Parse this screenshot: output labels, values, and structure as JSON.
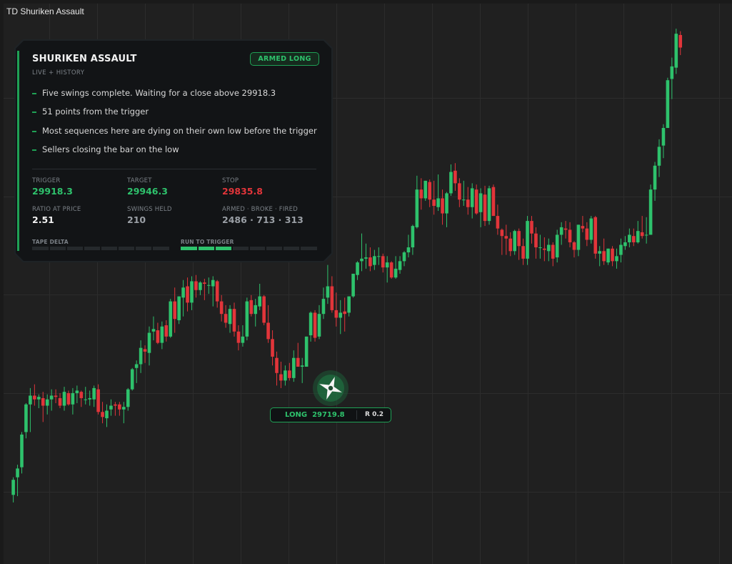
{
  "window": {
    "title": "TD Shuriken Assault"
  },
  "panel": {
    "title": "SHURIKEN ASSAULT",
    "subtitle": "LIVE + HISTORY",
    "status_badge": "ARMED LONG",
    "notes": [
      "Five swings complete. Waiting for a close above 29918.3",
      "51 points from the trigger",
      "Most sequences here are dying on their own low before the trigger",
      "Sellers closing the bar on the low"
    ],
    "stats": {
      "trigger": {
        "label": "TRIGGER",
        "value": "29918.3"
      },
      "target": {
        "label": "TARGET",
        "value": "29946.3"
      },
      "stop": {
        "label": "STOP",
        "value": "29835.8"
      },
      "ratio": {
        "label": "RATIO AT PRICE",
        "value": "2.51"
      },
      "swings": {
        "label": "SWINGS HELD",
        "value": "210"
      },
      "armed": {
        "label": "ARMED · BROKE · FIRED",
        "value": "2486 · 713 · 313"
      }
    },
    "tape_delta": {
      "label": "TAPE DELTA",
      "marker": 0.5
    },
    "run_to_trigger": {
      "label": "RUN TO TRIGGER",
      "progress": 0.375
    }
  },
  "trade_tag": {
    "side": "LONG",
    "price": "29719.8",
    "ratio": "R 0.2"
  },
  "colors": {
    "up": "#2ec26c",
    "down": "#e2353a",
    "accent": "#1fa155",
    "background": "#202020",
    "grid": "#2c2c2c"
  },
  "icons": {
    "signal": "shuriken-icon"
  },
  "chart_data": {
    "type": "candlestick",
    "title": "",
    "grid": true,
    "ylim": [
      29585,
      30031
    ],
    "candles": [
      [
        29640.0,
        29654.0,
        29634.0,
        29652.0
      ],
      [
        29654.0,
        29664.0,
        29639.0,
        29661.0
      ],
      [
        29662.0,
        29690.0,
        29657.0,
        29688.0
      ],
      [
        29690.0,
        29713.0,
        29685.0,
        29712.0
      ],
      [
        29712.0,
        29725.0,
        29690.0,
        29719.0
      ],
      [
        29719.0,
        29728.0,
        29711.0,
        29716.0
      ],
      [
        29716.0,
        29720.0,
        29709.0,
        29718.0
      ],
      [
        29717.0,
        29722.0,
        29698.0,
        29711.0
      ],
      [
        29711.0,
        29720.0,
        29704.0,
        29716.0
      ],
      [
        29716.0,
        29724.0,
        29707.0,
        29719.0
      ],
      [
        29719.0,
        29724.0,
        29713.0,
        29718.0
      ],
      [
        29717.0,
        29721.0,
        29709.0,
        29711.0
      ],
      [
        29711.0,
        29726.0,
        29707.0,
        29722.0
      ],
      [
        29721.0,
        29723.0,
        29711.0,
        29712.0
      ],
      [
        29712.0,
        29725.0,
        29704.0,
        29721.0
      ],
      [
        29721.0,
        29727.0,
        29713.0,
        29723.0
      ],
      [
        29722.0,
        29723.0,
        29710.0,
        29717.0
      ],
      [
        29716.0,
        29726.0,
        29712.0,
        29716.0
      ],
      [
        29716.0,
        29723.0,
        29711.0,
        29717.0
      ],
      [
        29716.0,
        29727.0,
        29710.0,
        29725.0
      ],
      [
        29724.0,
        29728.0,
        29704.0,
        29706.0
      ],
      [
        29706.0,
        29714.0,
        29697.0,
        29702.0
      ],
      [
        29701.0,
        29712.0,
        29694.0,
        29707.0
      ],
      [
        29708.0,
        29716.0,
        29703.0,
        29711.0
      ],
      [
        29712.0,
        29714.0,
        29703.0,
        29711.0
      ],
      [
        29712.0,
        29714.0,
        29703.0,
        29708.0
      ],
      [
        29708.0,
        29714.0,
        29697.0,
        29710.0
      ],
      [
        29710.0,
        29725.0,
        29707.0,
        29724.0
      ],
      [
        29724.0,
        29741.0,
        29723.0,
        29740.0
      ],
      [
        29741.0,
        29747.0,
        29729.0,
        29744.0
      ],
      [
        29744.0,
        29763.0,
        29737.0,
        29757.0
      ],
      [
        29756.0,
        29759.0,
        29745.0,
        29754.0
      ],
      [
        29753.0,
        29774.0,
        29743.0,
        29769.0
      ],
      [
        29770.0,
        29782.0,
        29763.0,
        29772.0
      ],
      [
        29771.0,
        29777.0,
        29760.0,
        29761.0
      ],
      [
        29761.0,
        29778.0,
        29756.0,
        29774.0
      ],
      [
        29775.0,
        29779.0,
        29762.0,
        29766.0
      ],
      [
        29766.0,
        29796.0,
        29765.0,
        29794.0
      ],
      [
        29794.0,
        29805.0,
        29769.0,
        29780.0
      ],
      [
        29779.0,
        29798.0,
        29776.0,
        29798.0
      ],
      [
        29797.0,
        29811.0,
        29782.0,
        29805.0
      ],
      [
        29806.0,
        29813.0,
        29786.0,
        29793.0
      ],
      [
        29793.0,
        29814.0,
        29787.0,
        29810.0
      ],
      [
        29810.0,
        29815.0,
        29797.0,
        29803.0
      ],
      [
        29803.0,
        29810.0,
        29799.0,
        29809.0
      ],
      [
        29809.0,
        29812.0,
        29795.0,
        29808.0
      ],
      [
        29807.0,
        29813.0,
        29800.0,
        29807.0
      ],
      [
        29806.0,
        29814.0,
        29790.0,
        29811.0
      ],
      [
        29810.0,
        29811.0,
        29789.0,
        29794.0
      ],
      [
        29794.0,
        29799.0,
        29778.0,
        29784.0
      ],
      [
        29784.0,
        29791.0,
        29773.0,
        29777.0
      ],
      [
        29776.0,
        29791.0,
        29769.0,
        29788.0
      ],
      [
        29788.0,
        29793.0,
        29766.0,
        29770.0
      ],
      [
        29770.0,
        29775.0,
        29755.0,
        29761.0
      ],
      [
        29761.0,
        29775.0,
        29758.0,
        29766.0
      ],
      [
        29766.0,
        29797.0,
        29763.0,
        29794.0
      ],
      [
        29795.0,
        29799.0,
        29782.0,
        29784.0
      ],
      [
        29784.0,
        29796.0,
        29774.0,
        29791.0
      ],
      [
        29790.0,
        29808.0,
        29787.0,
        29798.0
      ],
      [
        29798.0,
        29799.0,
        29775.0,
        29777.0
      ],
      [
        29777.0,
        29791.0,
        29761.0,
        29764.0
      ],
      [
        29764.0,
        29771.0,
        29743.0,
        29750.0
      ],
      [
        29749.0,
        29754.0,
        29727.0,
        29737.0
      ],
      [
        29736.0,
        29746.0,
        29725.0,
        29731.0
      ],
      [
        29731.0,
        29743.0,
        29727.0,
        29739.0
      ],
      [
        29739.0,
        29745.0,
        29731.0,
        29733.0
      ],
      [
        29733.0,
        29755.0,
        29730.0,
        29749.0
      ],
      [
        29749.0,
        29761.0,
        29742.0,
        29742.0
      ],
      [
        29742.0,
        29749.0,
        29729.0,
        29743.0
      ],
      [
        29742.0,
        29766.0,
        29742.0,
        29766.0
      ],
      [
        29767.0,
        29786.0,
        29762.0,
        29785.0
      ],
      [
        29785.0,
        29787.0,
        29762.0,
        29765.0
      ],
      [
        29766.0,
        29791.0,
        29764.0,
        29784.0
      ],
      [
        29784.0,
        29805.0,
        29780.0,
        29796.0
      ],
      [
        29797.0,
        29823.0,
        29792.0,
        29806.0
      ],
      [
        29806.0,
        29814.0,
        29785.0,
        29787.0
      ],
      [
        29787.0,
        29801.0,
        29774.0,
        29781.0
      ],
      [
        29781.0,
        29795.0,
        29768.0,
        29785.0
      ],
      [
        29786.0,
        29797.0,
        29770.0,
        29784.0
      ],
      [
        29785.0,
        29798.0,
        29782.0,
        29798.0
      ],
      [
        29798.0,
        29816.0,
        29797.0,
        29816.0
      ],
      [
        29815.0,
        29826.0,
        29811.0,
        29825.0
      ],
      [
        29826.0,
        29848.0,
        29818.0,
        29828.0
      ],
      [
        29828.0,
        29840.0,
        29820.0,
        29829.0
      ],
      [
        29829.0,
        29837.0,
        29818.0,
        29822.0
      ],
      [
        29823.0,
        29835.0,
        29819.0,
        29830.0
      ],
      [
        29830.0,
        29837.0,
        29823.0,
        29830.0
      ],
      [
        29830.0,
        29832.0,
        29817.0,
        29821.0
      ],
      [
        29821.0,
        29830.0,
        29809.0,
        29825.0
      ],
      [
        29825.0,
        29826.0,
        29812.0,
        29813.0
      ],
      [
        29813.0,
        29830.0,
        29812.0,
        29820.0
      ],
      [
        29819.0,
        29830.0,
        29816.0,
        29826.0
      ],
      [
        29826.0,
        29834.0,
        29822.0,
        29833.0
      ],
      [
        29833.0,
        29847.0,
        29829.0,
        29837.0
      ],
      [
        29837.0,
        29855.0,
        29831.0,
        29854.0
      ],
      [
        29853.0,
        29894.0,
        29852.0,
        29883.0
      ],
      [
        29883.0,
        29892.0,
        29867.0,
        29876.0
      ],
      [
        29876.0,
        29890.0,
        29874.0,
        29890.0
      ],
      [
        29889.0,
        29891.0,
        29869.0,
        29875.0
      ],
      [
        29875.0,
        29890.0,
        29863.0,
        29870.0
      ],
      [
        29869.0,
        29895.0,
        29866.0,
        29876.0
      ],
      [
        29876.0,
        29883.0,
        29855.0,
        29864.0
      ],
      [
        29864.0,
        29881.0,
        29853.0,
        29880.0
      ],
      [
        29880.0,
        29903.0,
        29878.0,
        29897.0
      ],
      [
        29898.0,
        29904.0,
        29882.0,
        29888.0
      ],
      [
        29888.0,
        29892.0,
        29869.0,
        29875.0
      ],
      [
        29875.0,
        29890.0,
        29870.0,
        29875.0
      ],
      [
        29875.0,
        29885.0,
        29863.0,
        29869.0
      ],
      [
        29869.0,
        29888.0,
        29860.0,
        29884.0
      ],
      [
        29883.0,
        29887.0,
        29863.0,
        29864.0
      ],
      [
        29865.0,
        29884.0,
        29853.0,
        29880.0
      ],
      [
        29879.0,
        29886.0,
        29854.0,
        29858.0
      ],
      [
        29858.0,
        29886.0,
        29855.0,
        29884.0
      ],
      [
        29885.0,
        29887.0,
        29862.0,
        29862.0
      ],
      [
        29862.0,
        29871.0,
        29847.0,
        29852.0
      ],
      [
        29851.0,
        29852.0,
        29831.0,
        29846.0
      ],
      [
        29846.0,
        29855.0,
        29831.0,
        29844.0
      ],
      [
        29844.0,
        29849.0,
        29830.0,
        29834.0
      ],
      [
        29834.0,
        29851.0,
        29831.0,
        29850.0
      ],
      [
        29850.0,
        29852.0,
        29827.0,
        29838.0
      ],
      [
        29838.0,
        29844.0,
        29823.0,
        29828.0
      ],
      [
        29828.0,
        29862.0,
        29823.0,
        29858.0
      ],
      [
        29858.0,
        29862.0,
        29840.0,
        29848.0
      ],
      [
        29848.0,
        29853.0,
        29828.0,
        29837.0
      ],
      [
        29837.0,
        29847.0,
        29828.0,
        29837.0
      ],
      [
        29836.0,
        29845.0,
        29826.0,
        29835.0
      ],
      [
        29834.0,
        29844.0,
        29826.0,
        29839.0
      ],
      [
        29839.0,
        29841.0,
        29822.0,
        29828.0
      ],
      [
        29829.0,
        29851.0,
        29825.0,
        29847.0
      ],
      [
        29847.0,
        29857.0,
        29839.0,
        29853.0
      ],
      [
        29852.0,
        29858.0,
        29844.0,
        29851.0
      ],
      [
        29851.0,
        29857.0,
        29837.0,
        29841.0
      ],
      [
        29841.0,
        29842.0,
        29829.0,
        29835.0
      ],
      [
        29835.0,
        29855.0,
        29830.0,
        29855.0
      ],
      [
        29854.0,
        29862.0,
        29849.0,
        29852.0
      ],
      [
        29852.0,
        29857.0,
        29838.0,
        29843.0
      ],
      [
        29843.0,
        29862.0,
        29840.0,
        29860.0
      ],
      [
        29861.0,
        29862.0,
        29828.0,
        29832.0
      ],
      [
        29832.0,
        29838.0,
        29822.0,
        29834.0
      ],
      [
        29834.0,
        29844.0,
        29823.0,
        29826.0
      ],
      [
        29825.0,
        29836.0,
        29823.0,
        29836.0
      ],
      [
        29836.0,
        29838.0,
        29822.0,
        29826.0
      ],
      [
        29826.0,
        29836.0,
        29820.0,
        29830.0
      ],
      [
        29831.0,
        29844.0,
        29825.0,
        29839.0
      ],
      [
        29838.0,
        29846.0,
        29835.0,
        29841.0
      ],
      [
        29841.0,
        29852.0,
        29837.0,
        29847.0
      ],
      [
        29846.0,
        29852.0,
        29838.0,
        29841.0
      ],
      [
        29841.0,
        29858.0,
        29840.0,
        29850.0
      ],
      [
        29849.0,
        29862.0,
        29844.0,
        29846.0
      ],
      [
        29847.0,
        29861.0,
        29840.0,
        29847.0
      ],
      [
        29847.0,
        29887.0,
        29847.0,
        29883.0
      ],
      [
        29883.0,
        29905.0,
        29874.0,
        29902.0
      ],
      [
        29902.0,
        29923.0,
        29893.0,
        29917.0
      ],
      [
        29918.0,
        29935.0,
        29908.0,
        29932.0
      ],
      [
        29932.0,
        29972.0,
        29932.0,
        29970.0
      ],
      [
        29971.0,
        29988.0,
        29955.0,
        29981.0
      ],
      [
        29980.0,
        30011.0,
        29975.0,
        30007.0
      ],
      [
        30006.0,
        30009.0,
        29990.0,
        29996.0
      ]
    ],
    "signal": {
      "candle_index": 64,
      "side": "long",
      "price": 29719.8
    }
  }
}
